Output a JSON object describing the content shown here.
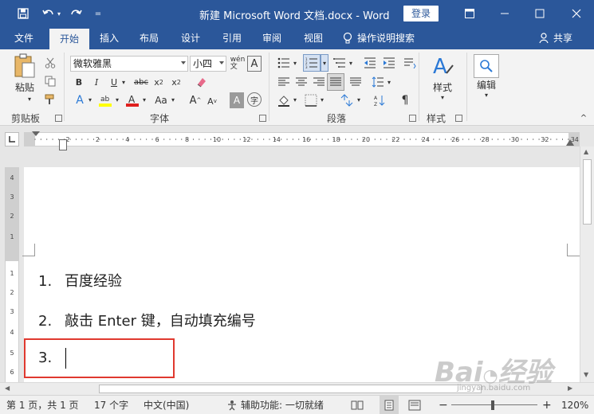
{
  "window": {
    "title": "新建 Microsoft Word 文档.docx - Word",
    "login_label": "登录"
  },
  "tabs": [
    {
      "label": "文件"
    },
    {
      "label": "开始"
    },
    {
      "label": "插入"
    },
    {
      "label": "布局"
    },
    {
      "label": "设计"
    },
    {
      "label": "引用"
    },
    {
      "label": "审阅"
    },
    {
      "label": "视图"
    }
  ],
  "tell_me": "操作说明搜索",
  "share": "共享",
  "ribbon": {
    "clipboard": {
      "paste_label": "粘贴",
      "group_label": "剪贴板"
    },
    "font": {
      "font_name": "微软雅黑",
      "font_size": "小四",
      "group_label": "字体"
    },
    "paragraph": {
      "group_label": "段落"
    },
    "styles": {
      "button_label": "样式",
      "group_label": "样式"
    },
    "editing": {
      "button_label": "编辑"
    }
  },
  "ruler": {
    "h_ticks": [
      "2",
      "2",
      "4",
      "6",
      "8",
      "10",
      "12",
      "14",
      "16",
      "18",
      "20",
      "22",
      "24",
      "26",
      "28",
      "30",
      "32",
      "34"
    ],
    "v_ticks": [
      "4",
      "3",
      "2",
      "1",
      "1",
      "2",
      "3",
      "4",
      "5",
      "6"
    ]
  },
  "document": {
    "items": [
      {
        "num": "1.",
        "text": "百度经验"
      },
      {
        "num": "2.",
        "text": "敲击 Enter 键，自动填充编号"
      },
      {
        "num": "3.",
        "text": ""
      }
    ]
  },
  "status": {
    "page": "第 1 页，共 1 页",
    "words": "17 个字",
    "language": "中文(中国)",
    "accessibility": "辅助功能: 一切就绪",
    "zoom": "120%"
  },
  "watermark": {
    "brand": "Bai经验",
    "url": "jingyan.baidu.com"
  },
  "colors": {
    "accent": "#2b579a",
    "highlight_box": "#e0392f"
  }
}
